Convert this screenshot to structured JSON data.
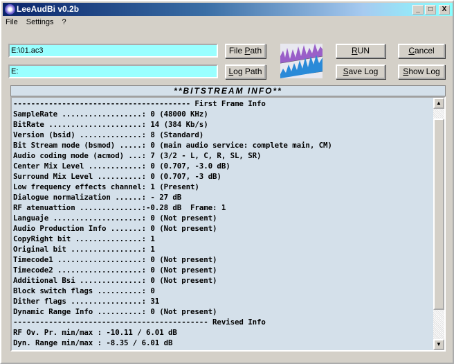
{
  "window": {
    "title": "LeeAudBi v0.2b",
    "minimize": "_",
    "maximize": "□",
    "close": "X"
  },
  "menu": [
    {
      "label": "File"
    },
    {
      "label": "Settings"
    },
    {
      "label": "?"
    }
  ],
  "inputs": {
    "file_path": "E:\\01.ac3",
    "log_path": "E:"
  },
  "buttons": {
    "file_path": "File Path",
    "log_path": "Log Path",
    "run": "RUN",
    "cancel": "Cancel",
    "save_log": "Save Log",
    "show_log": "Show Log"
  },
  "panel": {
    "header": "**BITSTREAM INFO**",
    "lines": [
      "---------------------------------------- First Frame Info",
      "SampleRate ..................: 0 (48000 KHz)",
      "BitRate .....................: 14 (384 Kb/s)",
      "Version (bsid) ..............: 8 (Standard)",
      "Bit Stream mode (bsmod) .....: 0 (main audio service: complete main, CM)",
      "Audio coding mode (acmod) ...: 7 (3/2 - L, C, R, SL, SR)",
      "Center Mix Level ............: 0 (0.707, -3.0 dB)",
      "Surround Mix Level ..........: 0 (0.707, -3 dB)",
      "Low frequency effects channel: 1 (Present)",
      "Dialogue normalization ......: - 27 dB",
      "RF atenuattion ..............:-0.28 dB  Frame: 1",
      "Languaje ....................: 0 (Not present)",
      "Audio Production Info .......: 0 (Not present)",
      "CopyRight bit ...............: 1",
      "Original bit ................: 1",
      "Timecode1 ...................: 0 (Not present)",
      "Timecode2 ...................: 0 (Not present)",
      "Additional Bsi ..............: 0 (Not present)",
      "Block switch flags ..........: 0",
      "Dither flags ................: 31",
      "Dynamic Range Info ..........: 0 (Not present)",
      "-------------------------------------------- Revised Info",
      "RF Ov. Pr. min/max : -10.11 / 6.01 dB",
      "Dyn. Range min/max : -8.35 / 6.01 dB"
    ]
  },
  "scroll": {
    "position_fraction": 0.0
  }
}
